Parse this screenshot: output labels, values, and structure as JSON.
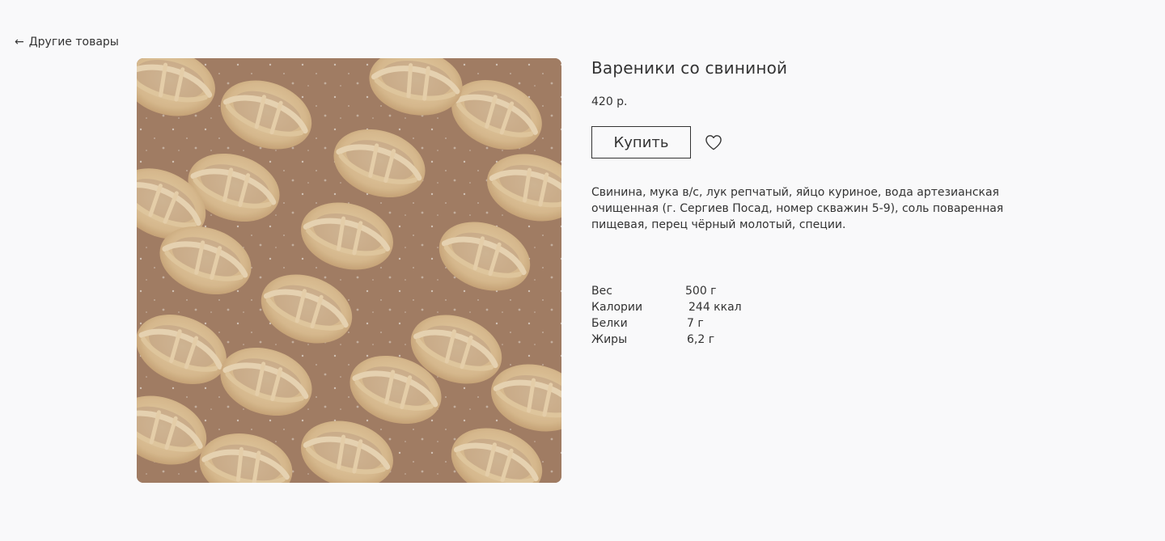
{
  "nav": {
    "back_label": "Другие товары",
    "back_icon": "arrow-left-icon"
  },
  "product": {
    "title": "Вареники со свининой",
    "price": "420 р.",
    "buy_label": "Купить",
    "favorite_icon": "heart-icon",
    "description": "Свинина, мука в/с, лук репчатый, яйцо куриное, вода артезианская очищенная (г. Сергиев Посад, номер скважин 5-9), соль поваренная пищевая, перец чёрный молотый, специи.",
    "specs": [
      {
        "label": "Вес",
        "value": "500 г"
      },
      {
        "label": "Калории",
        "value": "244 ккал"
      },
      {
        "label": "Белки",
        "value": "7 г"
      },
      {
        "label": "Жиры",
        "value": "6,2 г"
      }
    ]
  },
  "colors": {
    "background": "#f9f9fa",
    "text": "#333333",
    "dough": "#e8cfa4",
    "paper": "#a9846a"
  }
}
